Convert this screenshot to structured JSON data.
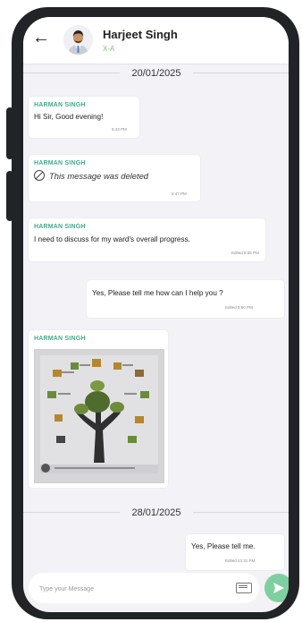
{
  "header": {
    "back_icon": "arrow-left-icon",
    "name": "Harjeet Singh",
    "subtitle": "X-A"
  },
  "dates": [
    "20/01/2025",
    "28/01/2025"
  ],
  "messages": [
    {
      "sender": "HARMAN SINGH",
      "text": "Hi Sir, Good evening!",
      "time": "5:43 PM"
    },
    {
      "sender": "HARMAN SINGH",
      "text": "This message was deleted",
      "time": "5:47 PM",
      "icon": "ban-icon"
    },
    {
      "sender": "HARMAN SINGH",
      "text": "I need to discuss for my ward's overall progress.",
      "time": "Edited 8:55 PM"
    },
    {
      "text": "Yes, Please tell me how can I help you ?",
      "time": "Edited 5:50 PM"
    },
    {
      "sender": "HARMAN SINGH",
      "image": "tree-poster-image"
    },
    {
      "text": "Yes, Please tell me.",
      "time": "Edited 12:31 PM"
    }
  ],
  "composer": {
    "placeholder": "Type your Message",
    "keyboard_icon": "keyboard-icon",
    "send_icon": "send-icon",
    "send_color": "#7fcfa0"
  },
  "colors": {
    "sender": "#45a88b",
    "subtitle": "#7fc36f",
    "background": "#f3f2f6",
    "frame": "#222326"
  }
}
